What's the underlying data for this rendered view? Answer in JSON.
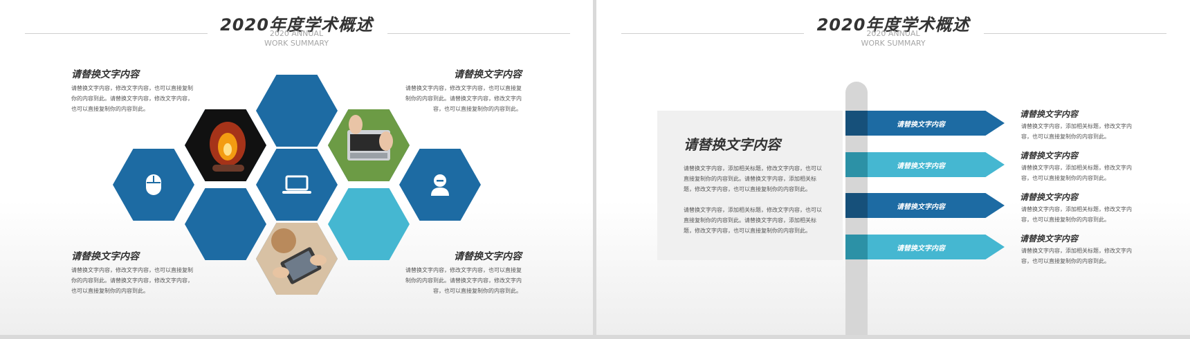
{
  "left_slide": {
    "title": "2020年度学术概述",
    "subtitle": "2020 ANNUAL WORK SUMMARY",
    "blocks": [
      {
        "title": "请替换文字内容",
        "desc": "请替换文字内容，修改文字内容，也可以直接复制你的内容到此。请替换文字内容，修改文字内容，也可以直接复制你的内容到此。"
      },
      {
        "title": "请替换文字内容",
        "desc": "请替换文字内容，修改文字内容，也可以直接复制你的内容到此。请替换文字内容，修改文字内容，也可以直接复制你的内容到此。"
      },
      {
        "title": "请替换文字内容",
        "desc": "请替换文字内容，修改文字内容，也可以直接复制你的内容到此。请替换文字内容，修改文字内容，也可以直接复制你的内容到此。"
      },
      {
        "title": "请替换文字内容",
        "desc": "请替换文字内容，修改文字内容，也可以直接复制你的内容到此。请替换文字内容，修改文字内容，也可以直接复制你的内容到此。"
      }
    ],
    "icons": [
      "mouse-icon",
      "laptop-icon",
      "user-icon"
    ],
    "colors": {
      "dark_blue": "#1d6ba3",
      "light_blue": "#45b7d1"
    }
  },
  "right_slide": {
    "title": "2020年度学术概述",
    "subtitle": "2020 ANNUAL WORK SUMMARY",
    "panel": {
      "title": "请替换文字内容",
      "para1": "请替换文字内容，添加相关标题，修改文字内容，也可以直接复制你的内容到此。请替换文字内容，添加相关标题，修改文字内容，也可以直接复制你的内容到此。",
      "para2": "请替换文字内容，添加相关标题，修改文字内容，也可以直接复制你的内容到此。请替换文字内容，添加相关标题，修改文字内容，也可以直接复制你的内容到此。"
    },
    "arrows": [
      {
        "label": "请替换文字内容"
      },
      {
        "label": "请替换文字内容"
      },
      {
        "label": "请替换文字内容"
      },
      {
        "label": "请替换文字内容"
      }
    ],
    "items": [
      {
        "title": "请替换文字内容",
        "desc": "请替换文字内容，添加相关标题，修改文字内容，也可以直接复制你的内容到此。"
      },
      {
        "title": "请替换文字内容",
        "desc": "请替换文字内容，添加相关标题，修改文字内容，也可以直接复制你的内容到此。"
      },
      {
        "title": "请替换文字内容",
        "desc": "请替换文字内容，添加相关标题，修改文字内容，也可以直接复制你的内容到此。"
      },
      {
        "title": "请替换文字内容",
        "desc": "请替换文字内容，添加相关标题，修改文字内容，也可以直接复制你的内容到此。"
      }
    ],
    "colors": {
      "dark_blue": "#1d6ba3",
      "light_blue": "#45b7d1",
      "cap_dark": "#16507a",
      "cap_light": "#2c91a6"
    }
  }
}
